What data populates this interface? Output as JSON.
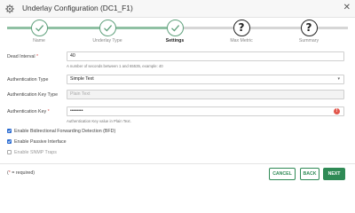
{
  "header": {
    "title": "Underlay Configuration (DC1_F1)",
    "close_glyph": "✕",
    "icon": "gear-icon"
  },
  "stepper": {
    "steps": [
      {
        "label": "Name",
        "state": "complete"
      },
      {
        "label": "Underlay Type",
        "state": "complete"
      },
      {
        "label": "Settings",
        "state": "active"
      },
      {
        "label": "Max Metric",
        "state": "pending"
      },
      {
        "label": "Summary",
        "state": "pending"
      }
    ],
    "pending_glyph": "?"
  },
  "form": {
    "dead_interval": {
      "label": "Dead Interval",
      "required_mark": "*",
      "value": "40",
      "help": "A number of seconds between 1 and 65535, example: 40"
    },
    "auth_type": {
      "label": "Authentication Type",
      "value": "Simple Text"
    },
    "auth_key_type": {
      "label": "Authentication Key Type",
      "value": "Plain Text"
    },
    "auth_key": {
      "label": "Authentication Key",
      "required_mark": "*",
      "value": "••••••••",
      "help": "Authentication Key value in Plain Text."
    },
    "checkboxes": [
      {
        "label": "Enable Bidirectional Forwarding Detection (BFD)",
        "checked": true
      },
      {
        "label": "Enable Passive Interface",
        "checked": true
      },
      {
        "label": "Enable SNMP Traps",
        "checked": false
      }
    ]
  },
  "footer": {
    "required_note_star": "*",
    "required_note_prefix": "(",
    "required_note_suffix": " = required)",
    "cancel_label": "CANCEL",
    "back_label": "BACK",
    "next_label": "NEXT"
  },
  "colors": {
    "accent": "#2f8a55",
    "step_complete": "#5fa07c",
    "required": "#d9534f",
    "checkbox": "#2a6bd1"
  }
}
